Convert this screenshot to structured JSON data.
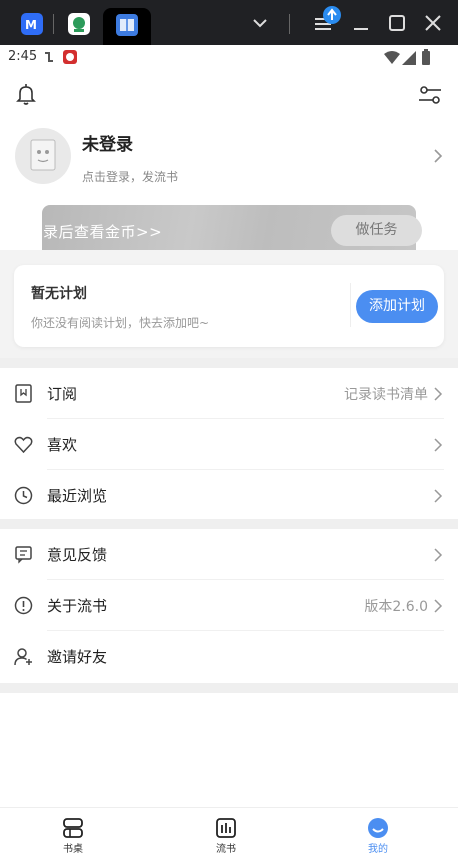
{
  "status_bar": {
    "time": "2:45"
  },
  "profile": {
    "name": "未登录",
    "subtitle": "点击登录，发流书"
  },
  "banner": {
    "text": "录后查看金币>>",
    "button": "做任务"
  },
  "plan": {
    "title": "暂无计划",
    "subtitle": "你还没有阅读计划，快去添加吧~",
    "button": "添加计划"
  },
  "menu_group_1": [
    {
      "label": "订阅",
      "value": "记录读书清单",
      "icon": "bookmark-icon"
    },
    {
      "label": "喜欢",
      "value": "",
      "icon": "heart-icon"
    },
    {
      "label": "最近浏览",
      "value": "",
      "icon": "clock-icon"
    }
  ],
  "menu_group_2": [
    {
      "label": "意见反馈",
      "value": "",
      "icon": "feedback-icon"
    },
    {
      "label": "关于流书",
      "value": "版本2.6.0",
      "icon": "info-icon"
    },
    {
      "label": "邀请好友",
      "value": "",
      "icon": "add-user-icon"
    }
  ],
  "bottom_nav": [
    {
      "label": "书桌",
      "icon": "desk-icon",
      "active": false
    },
    {
      "label": "流书",
      "icon": "chart-icon",
      "active": false
    },
    {
      "label": "我的",
      "icon": "profile-face-icon",
      "active": true
    }
  ],
  "colors": {
    "accent": "#4b8ef1",
    "topbar": "#202124",
    "section_gap": "#efefef",
    "text_secondary": "#999999"
  }
}
